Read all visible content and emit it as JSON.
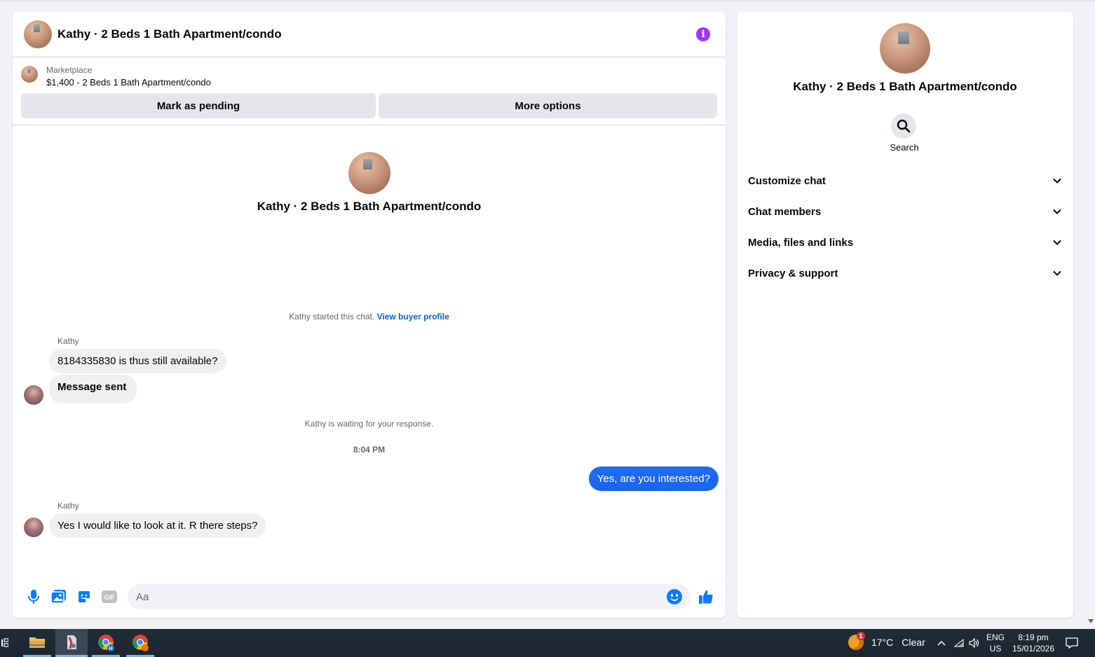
{
  "header": {
    "title": "Kathy · 2 Beds 1 Bath Apartment/condo"
  },
  "listing": {
    "source": "Marketplace",
    "price_line": "$1,400 - 2 Beds 1 Bath Apartment/condo",
    "mark_pending_label": "Mark as pending",
    "more_options_label": "More options"
  },
  "intro": {
    "title": "Kathy · 2 Beds 1 Bath Apartment/condo"
  },
  "conversation": {
    "started_text": "Kathy started this chat.",
    "view_profile_link": "View buyer profile",
    "sender1": "Kathy",
    "msg1": "8184335830 is thus still available?",
    "msg2": "Message sent",
    "waiting_text": "Kathy is waiting for your response.",
    "timestamp": "8:04 PM",
    "outgoing1": "Yes, are you interested?",
    "sender2": "Kathy",
    "msg3": "Yes I would like to look at it. R there steps?"
  },
  "composer": {
    "placeholder": "Aa",
    "gif_label": "GIF"
  },
  "side_panel": {
    "title": "Kathy · 2 Beds 1 Bath Apartment/condo",
    "search_label": "Search",
    "sections": [
      "Customize chat",
      "Chat members",
      "Media, files and links",
      "Privacy & support"
    ]
  },
  "taskbar": {
    "weather_badge": "1",
    "temperature": "17°C",
    "condition": "Clear",
    "lang_top": "ENG",
    "lang_bottom": "US",
    "time": "8:19 pm",
    "date": "15/01/2026"
  },
  "colors": {
    "accent_blue": "#0a7cff",
    "info_purple": "#a033ff",
    "link_blue": "#0064d1"
  }
}
